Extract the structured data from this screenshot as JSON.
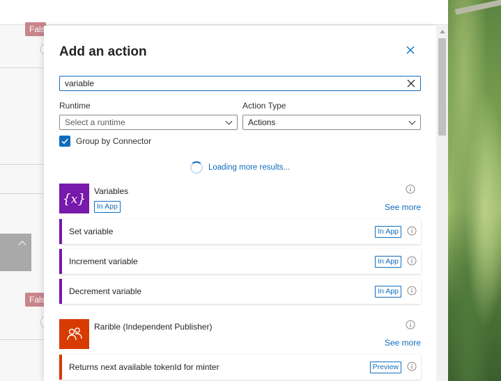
{
  "background": {
    "false_label": "False"
  },
  "panel": {
    "title": "Add an action",
    "search": {
      "value": "variable",
      "placeholder": ""
    },
    "runtime": {
      "label": "Runtime",
      "placeholder": "Select a runtime"
    },
    "action_type": {
      "label": "Action Type",
      "value": "Actions"
    },
    "group_by_connector": {
      "label": "Group by Connector",
      "checked": true
    },
    "loading_text": "Loading more results...",
    "connectors": [
      {
        "name": "Variables",
        "tag": "In App",
        "icon": "variables-icon",
        "color": "#7719aa",
        "see_more": "See more",
        "actions": [
          {
            "label": "Set variable",
            "tag": "In App"
          },
          {
            "label": "Increment variable",
            "tag": "In App"
          },
          {
            "label": "Decrement variable",
            "tag": "In App"
          }
        ]
      },
      {
        "name": "Rarible (Independent Publisher)",
        "icon": "rarible-icon",
        "color": "#d83b01",
        "see_more": "See more",
        "actions": [
          {
            "label": "Returns next available tokenId for minter",
            "tag": "Preview"
          }
        ]
      }
    ]
  },
  "colors": {
    "accent": "#0f6cbd",
    "variables": "#7719aa",
    "rarible": "#d83b01",
    "false_tag": "#c9858c"
  }
}
